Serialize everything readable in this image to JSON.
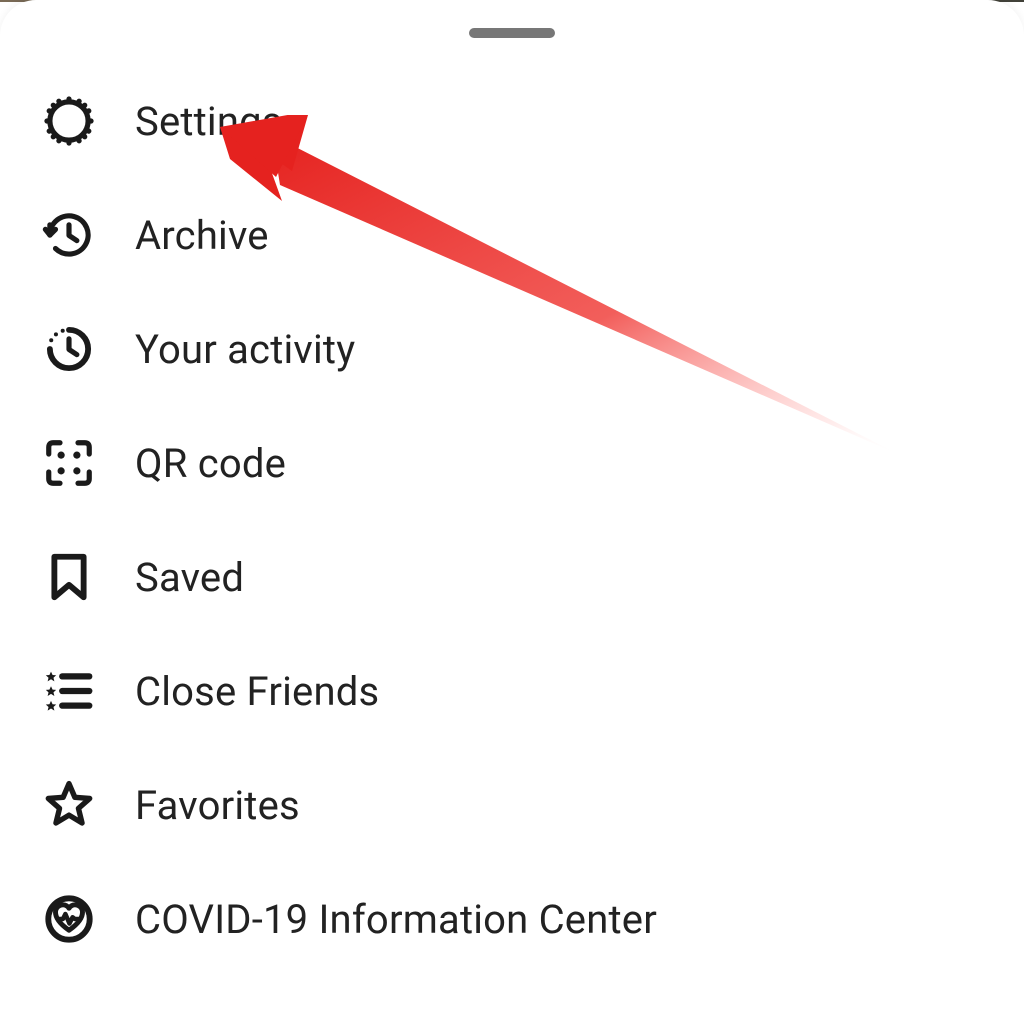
{
  "menu": {
    "items": [
      {
        "label": "Settings",
        "icon": "gear-icon"
      },
      {
        "label": "Archive",
        "icon": "history-icon"
      },
      {
        "label": "Your activity",
        "icon": "activity-icon"
      },
      {
        "label": "QR code",
        "icon": "qrcode-icon"
      },
      {
        "label": "Saved",
        "icon": "bookmark-icon"
      },
      {
        "label": "Close Friends",
        "icon": "close-friends-list-icon"
      },
      {
        "label": "Favorites",
        "icon": "star-icon"
      },
      {
        "label": "COVID-19 Information Center",
        "icon": "heart-badge-icon"
      }
    ]
  },
  "annotation": {
    "arrow_color": "#e5221f",
    "target_item_index": 0
  }
}
